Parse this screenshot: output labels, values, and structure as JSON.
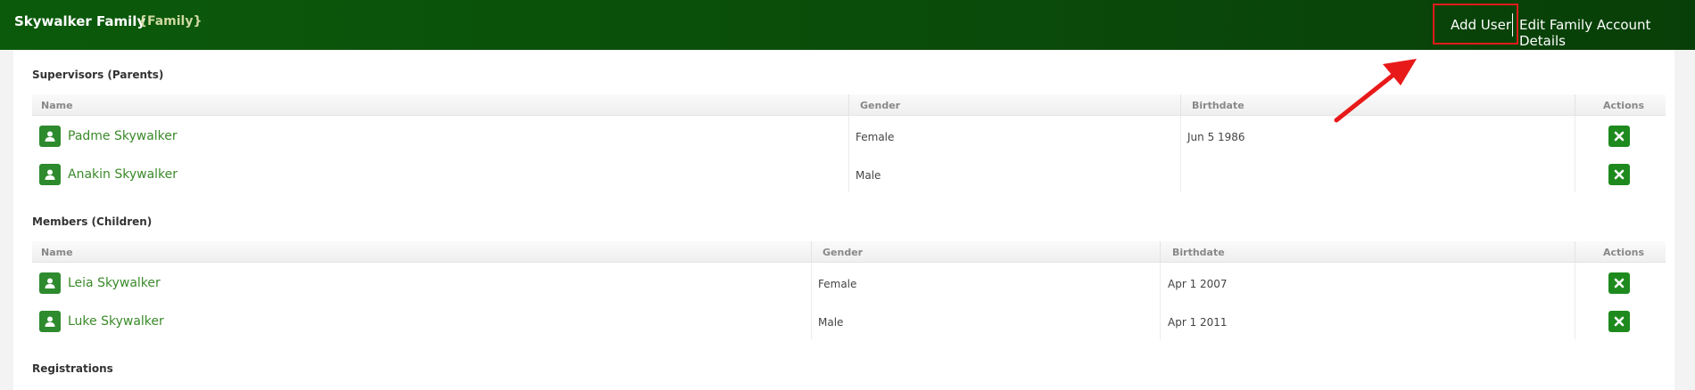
{
  "header": {
    "title": "Skywalker Family",
    "subtitle": "{Family}",
    "add_user": "Add User",
    "edit_details": "Edit Family Account Details"
  },
  "supervisors": {
    "title": "Supervisors (Parents)",
    "columns": {
      "name": "Name",
      "gender": "Gender",
      "birthdate": "Birthdate",
      "actions": "Actions"
    },
    "rows": [
      {
        "name": "Padme Skywalker",
        "gender": "Female",
        "birthdate": "Jun 5 1986"
      },
      {
        "name": "Anakin Skywalker",
        "gender": "Male",
        "birthdate": ""
      }
    ]
  },
  "members": {
    "title": "Members (Children)",
    "columns": {
      "name": "Name",
      "gender": "Gender",
      "birthdate": "Birthdate",
      "actions": "Actions"
    },
    "rows": [
      {
        "name": "Leia Skywalker",
        "gender": "Female",
        "birthdate": "Apr 1 2007"
      },
      {
        "name": "Luke Skywalker",
        "gender": "Male",
        "birthdate": "Apr 1 2011"
      }
    ]
  },
  "registrations": {
    "title": "Registrations"
  },
  "colors": {
    "header_bg": "#0a4a0a",
    "accent_green": "#1e8a1e",
    "highlight_red": "#e01b1b",
    "link_green": "#3a8a2a"
  },
  "icons": {
    "avatar": "user-icon",
    "remove": "close-icon",
    "annotation": "red-arrow-icon"
  }
}
